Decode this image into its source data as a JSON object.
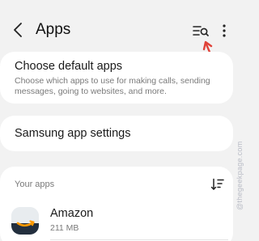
{
  "header": {
    "title": "Apps",
    "back_icon": "chevron-left-icon",
    "filter_icon": "filter-search-icon",
    "more_icon": "more-vertical-icon"
  },
  "default_apps": {
    "title": "Choose default apps",
    "description": "Choose which apps to use for making calls, sending messages, going to websites, and more."
  },
  "samsung_settings": {
    "title": "Samsung app settings"
  },
  "your_apps": {
    "label": "Your apps",
    "sort_icon": "sort-icon",
    "items": [
      {
        "name": "Amazon",
        "size": "211 MB",
        "icon": "amazon-app-icon"
      }
    ]
  },
  "watermark": "@thegeekpage.com",
  "colors": {
    "background": "#f2f2f2",
    "card": "#ffffff",
    "annotation_arrow": "#e0433a"
  }
}
